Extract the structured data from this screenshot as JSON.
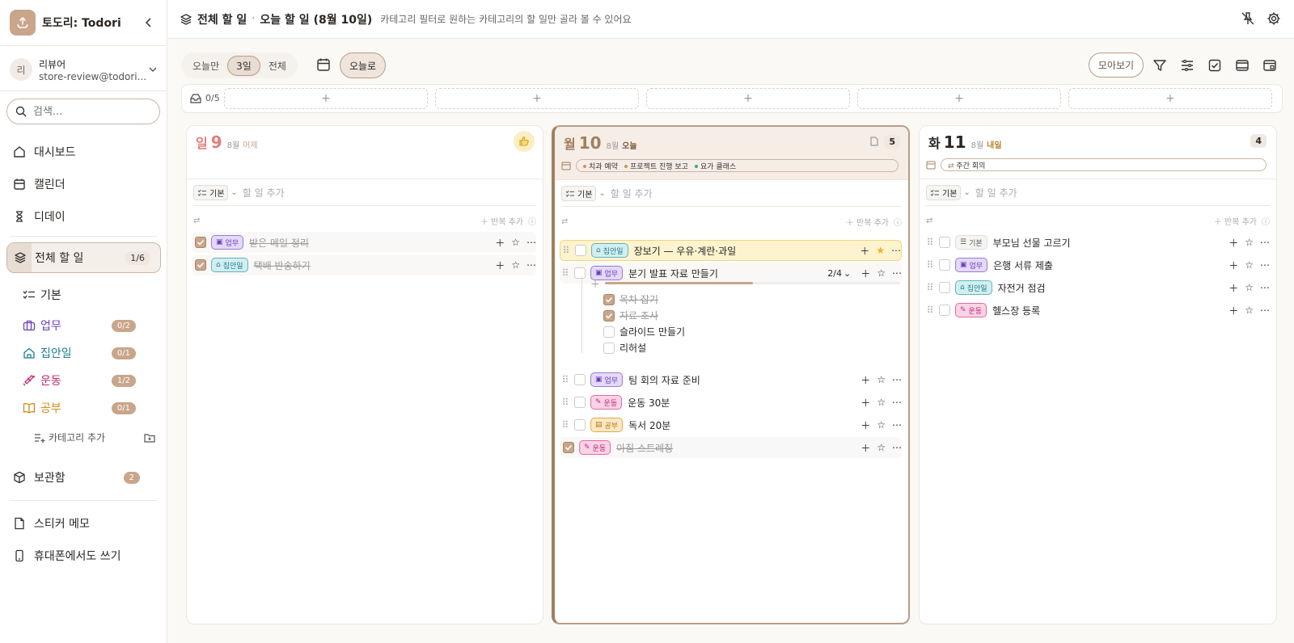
{
  "app": {
    "title": "토도리: Todori"
  },
  "user": {
    "avatar": "리",
    "name": "리뷰어",
    "email": "store-review@todori..."
  },
  "search": {
    "placeholder": "검색..."
  },
  "nav": [
    {
      "label": "대시보드",
      "icon": "home-icon"
    },
    {
      "label": "캘린더",
      "icon": "calendar-icon"
    },
    {
      "label": "디데이",
      "icon": "hourglass-icon"
    }
  ],
  "all_todos": {
    "label": "전체 할 일",
    "count": "1/6"
  },
  "categories": [
    {
      "label": "기본",
      "count": "",
      "color": "#2a2622"
    },
    {
      "label": "업무",
      "count": "0/2",
      "color": "#6a3fc0"
    },
    {
      "label": "집안일",
      "count": "0/1",
      "color": "#1c7f8c"
    },
    {
      "label": "운동",
      "count": "1/2",
      "color": "#c12a76"
    },
    {
      "label": "공부",
      "count": "0/1",
      "color": "#d08a14"
    }
  ],
  "add_category": "카테고리 추가",
  "archive": {
    "label": "보관함",
    "count": "2"
  },
  "sticker_memo": "스티커 메모",
  "mobile": "휴대폰에서도 쓰기",
  "topbar": {
    "title": "전체 할 일",
    "dot": "·",
    "subtitle": "오늘 할 일 (8월 10일)",
    "hint": "카테고리 필터로 원하는 카테고리의 할 일만 골라 볼 수 있어요"
  },
  "range": {
    "today_only": "오늘만",
    "three_days": "3일",
    "all": "전체"
  },
  "today_button": "오늘로",
  "collect_button": "모아보기",
  "inbox": {
    "count": "0/5"
  },
  "common": {
    "add_placeholder": "할 일 추가",
    "base_chip": "기본",
    "add_repeat": "반복 추가"
  },
  "columns": [
    {
      "weekday": "일",
      "day": "9",
      "month": "8월",
      "relative": "어제",
      "count": "",
      "events": [],
      "tasks": [
        {
          "done": true,
          "category": "업무",
          "cat_class": "work",
          "text": "받은 메일 정리",
          "starred": false
        },
        {
          "done": true,
          "category": "집안일",
          "cat_class": "home",
          "text": "택배 반송하기",
          "starred": false
        }
      ]
    },
    {
      "weekday": "월",
      "day": "10",
      "month": "8월",
      "relative": "오늘",
      "count": "5",
      "events": [
        "치과 예약",
        "프로젝트 진행 보고",
        "요가 클래스"
      ],
      "tasks": [
        {
          "done": false,
          "category": "집안일",
          "cat_class": "home",
          "text": "장보기 — 우유·계란·과일",
          "starred": true
        },
        {
          "done": false,
          "category": "업무",
          "cat_class": "work",
          "text": "분기 발표 자료 만들기",
          "starred": false,
          "subtasks_count": "2/4",
          "progress": 0.5,
          "subtasks": [
            {
              "done": true,
              "text": "목차 잡기"
            },
            {
              "done": true,
              "text": "자료 조사"
            },
            {
              "done": false,
              "text": "슬라이드 만들기"
            },
            {
              "done": false,
              "text": "리허설"
            }
          ]
        },
        {
          "done": false,
          "category": "업무",
          "cat_class": "work",
          "text": "팀 회의 자료 준비",
          "starred": false
        },
        {
          "done": false,
          "category": "운동",
          "cat_class": "sport",
          "text": "운동 30분",
          "starred": false
        },
        {
          "done": false,
          "category": "공부",
          "cat_class": "study",
          "text": "독서 20분",
          "starred": false
        },
        {
          "done": true,
          "category": "운동",
          "cat_class": "sport",
          "text": "아침 스트레칭",
          "starred": false
        }
      ]
    },
    {
      "weekday": "화",
      "day": "11",
      "month": "8월",
      "relative": "내일",
      "count": "4",
      "events": [
        "주간 회의"
      ],
      "tasks": [
        {
          "done": false,
          "category": "기본",
          "cat_class": "base",
          "text": "부모님 선물 고르기",
          "starred": false
        },
        {
          "done": false,
          "category": "업무",
          "cat_class": "work",
          "text": "은행 서류 제출",
          "starred": false
        },
        {
          "done": false,
          "category": "집안일",
          "cat_class": "home",
          "text": "자전거 점검",
          "starred": false
        },
        {
          "done": false,
          "category": "운동",
          "cat_class": "sport",
          "text": "헬스장 등록",
          "starred": false
        }
      ]
    }
  ],
  "colors": {
    "accent": "#c9a58a",
    "sunday": "#e0807a",
    "today_accent": "#a0805e",
    "tomorrow": "#b8862e"
  }
}
